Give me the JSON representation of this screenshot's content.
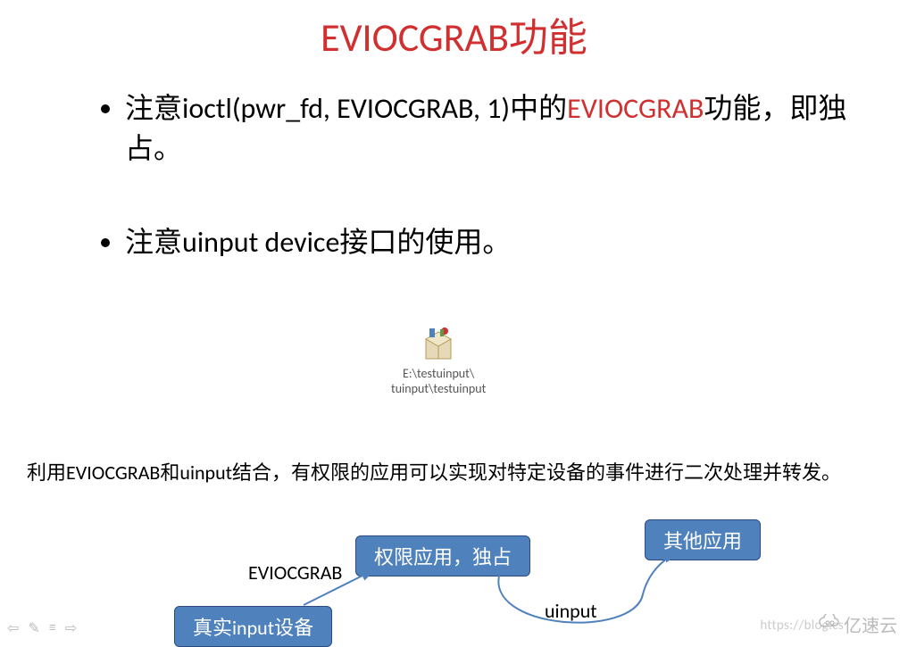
{
  "title": "EVIOCGRAB功能",
  "bullets": [
    {
      "pre": "注意ioctl(pwr_fd, EVIOCGRAB, 1)中的",
      "red": "EVIOCGRAB",
      "post": "功能，即独占。"
    },
    {
      "pre": "注意uinput device接口的使用。",
      "red": "",
      "post": ""
    }
  ],
  "fileLabelLine1": "E:\\testuinput\\",
  "fileLabelLine2": "tuinput\\testuinput",
  "summary": "利用EVIOCGRAB和uinput结合，有权限的应用可以实现对特定设备的事件进行二次处理并转发。",
  "boxes": {
    "other": "其他应用",
    "priv": "权限应用，独占",
    "real": "真实input设备"
  },
  "labels": {
    "eviocgrab": "EVIOCGRAB",
    "uinput": "uinput"
  },
  "watermark": "https://blog.cs",
  "logoText": "亿速云"
}
